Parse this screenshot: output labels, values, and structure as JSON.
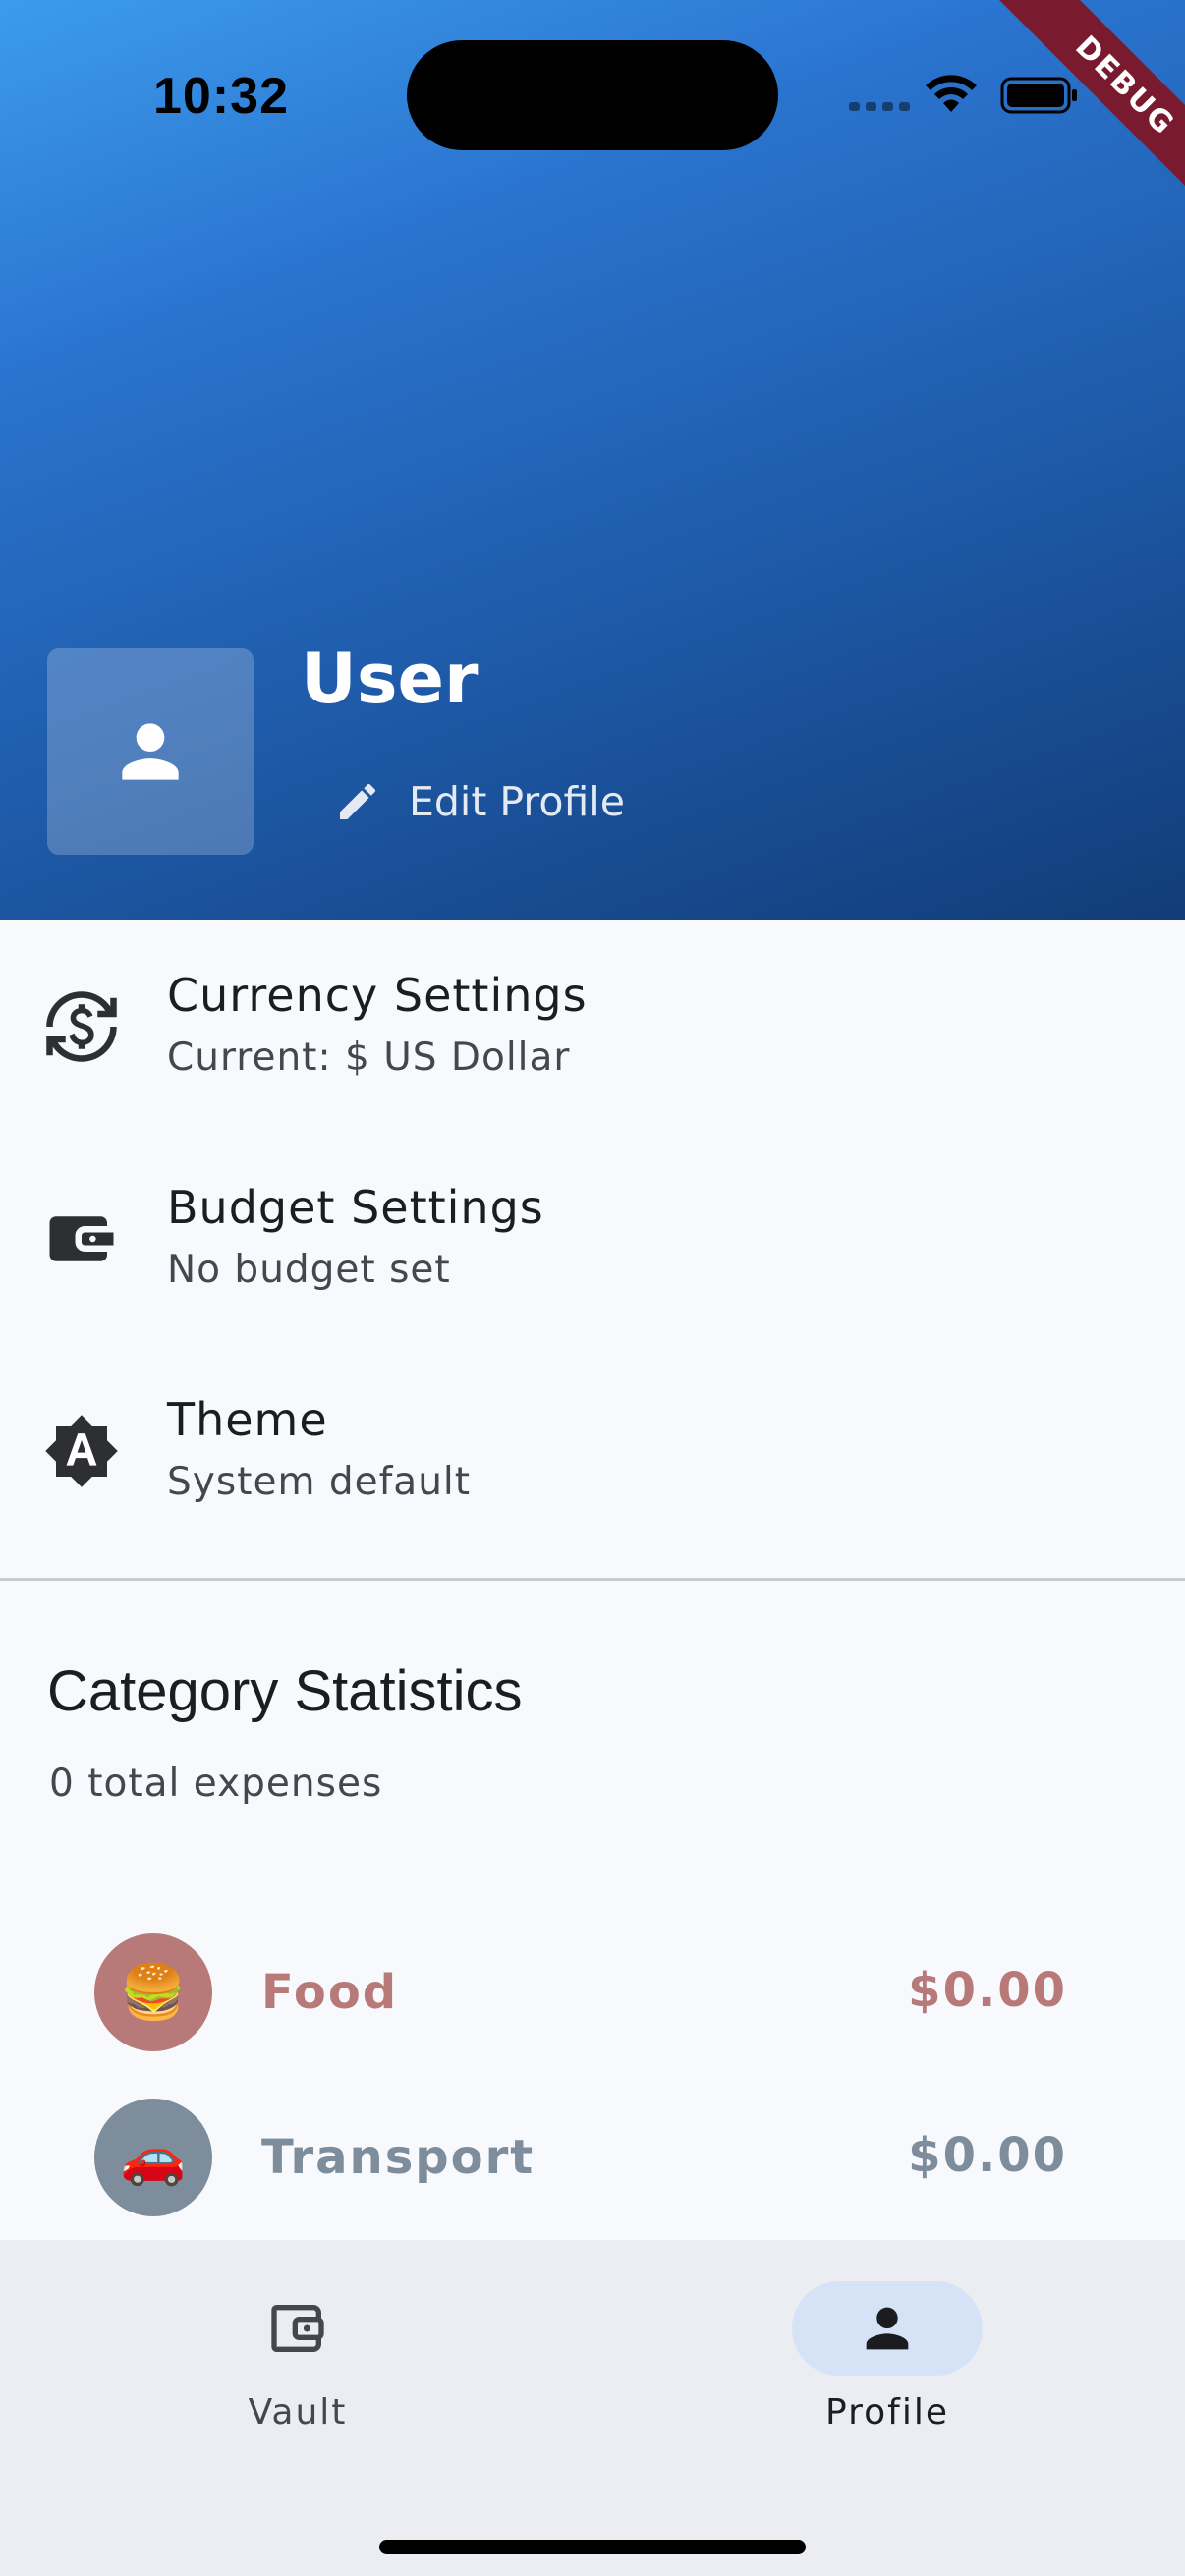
{
  "status_bar": {
    "time": "10:32",
    "debug_label": "DEBUG"
  },
  "profile": {
    "name": "User",
    "edit_label": "Edit Profile"
  },
  "settings": [
    {
      "title": "Currency Settings",
      "subtitle": "Current: $ US Dollar",
      "icon": "currency-exchange-icon"
    },
    {
      "title": "Budget Settings",
      "subtitle": "No budget set",
      "icon": "wallet-icon"
    },
    {
      "title": "Theme",
      "subtitle": "System default",
      "icon": "brightness-auto-icon"
    }
  ],
  "stats": {
    "title": "Category Statistics",
    "subtitle": "0 total expenses",
    "categories": [
      {
        "emoji": "🍔",
        "name": "Food",
        "amount": "$0.00",
        "color": "#b77a78",
        "bg": "#b77a78"
      },
      {
        "emoji": "🚗",
        "name": "Transport",
        "amount": "$0.00",
        "color": "#7d8d9b",
        "bg": "#7d8d9b"
      }
    ]
  },
  "nav": {
    "items": [
      {
        "label": "Vault",
        "icon": "wallet-icon",
        "active": false
      },
      {
        "label": "Profile",
        "icon": "person-icon",
        "active": true
      }
    ]
  },
  "colors": {
    "header_gradient_start": "#3c9bec",
    "header_gradient_end": "#123c78",
    "nav_active_pill": "#d6e3f7",
    "debug_banner": "#7a1a2e"
  }
}
